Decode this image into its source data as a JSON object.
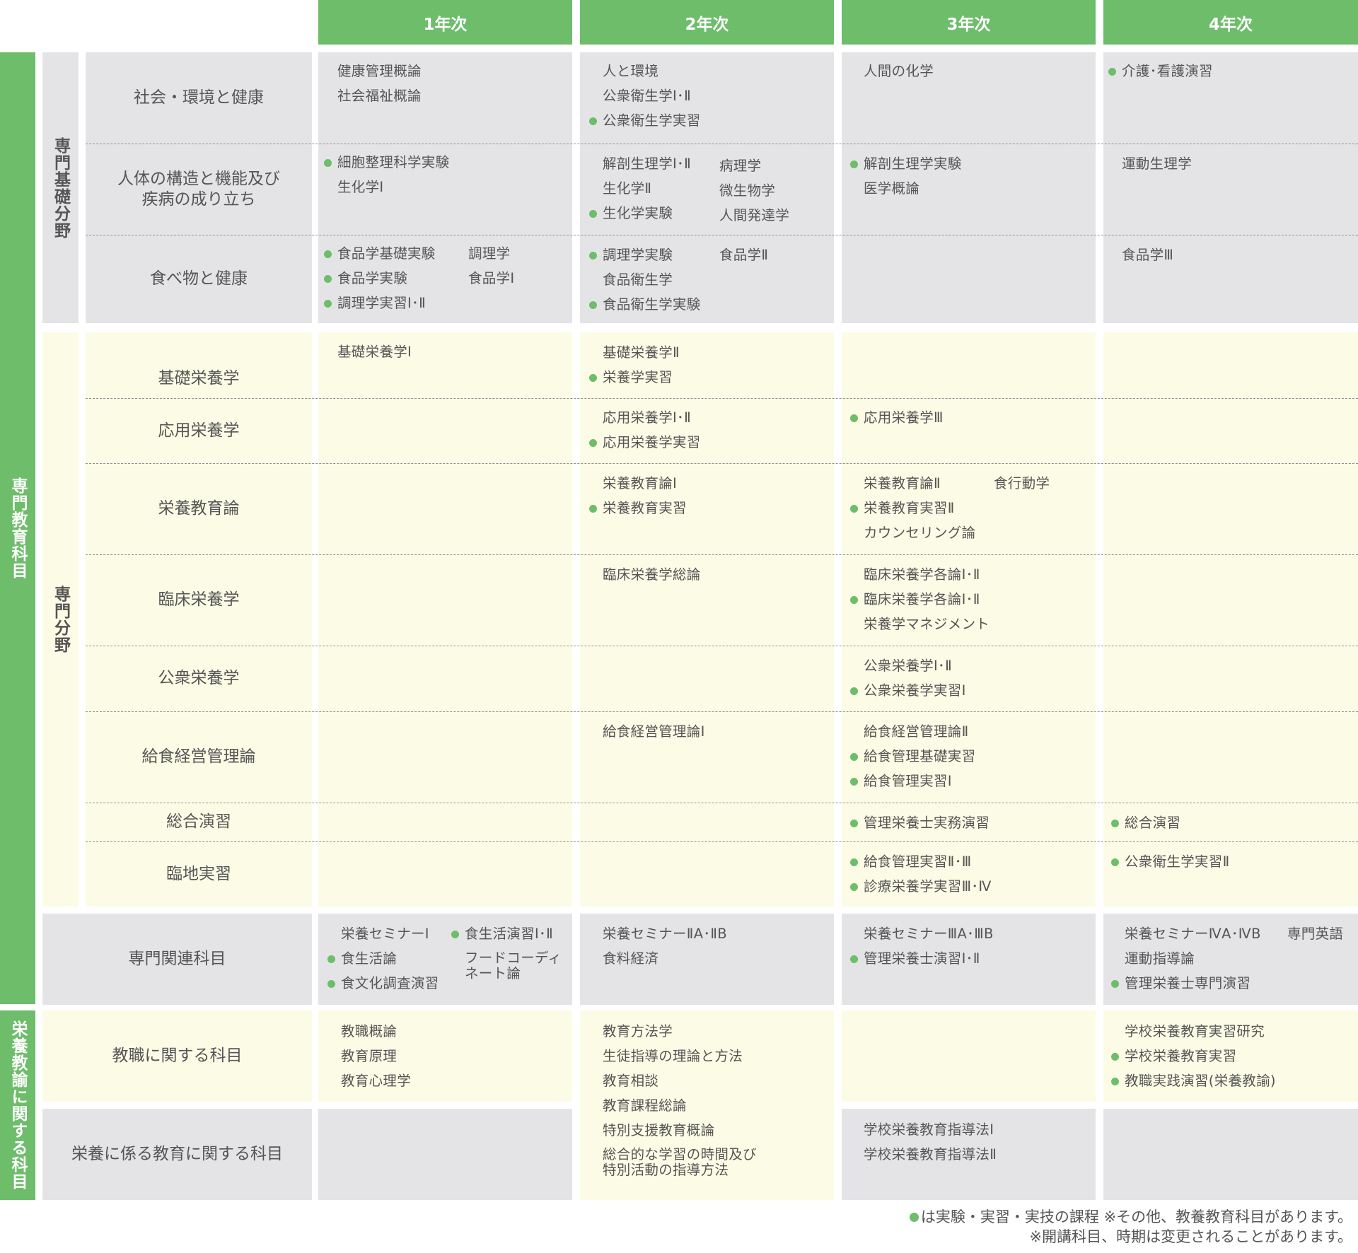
{
  "years": [
    "1年次",
    "2年次",
    "3年次",
    "4年次"
  ],
  "groups": {
    "senmon_kyoiku": "専門教育科目",
    "eiyo_kyoyu": "栄養教諭に関する科目"
  },
  "subgroups": {
    "kiso": "専門基礎分野",
    "senmon": "専門分野"
  },
  "rows": {
    "r1": {
      "label": "社会・環境と健康",
      "y1": [
        "健康管理概論",
        "社会福祉概論"
      ],
      "y2": [
        "人と環境",
        "公衆衛生学Ⅰ･Ⅱ",
        "公衆衛生学実習"
      ],
      "y3": [
        "人間の化学"
      ],
      "y4": [
        "介護･看護演習"
      ]
    },
    "r2": {
      "label": "人体の構造と機能及び\n疾病の成り立ち",
      "y1": [
        "細胞整理科学実験",
        "生化学Ⅰ"
      ],
      "y2": [
        "解剖生理学Ⅰ･Ⅱ",
        "生化学Ⅱ",
        "生化学実験",
        "病理学",
        "微生物学",
        "人間発達学"
      ],
      "y3": [
        "解剖生理学実験",
        "医学概論"
      ],
      "y4": [
        "運動生理学"
      ]
    },
    "r3": {
      "label": "食べ物と健康",
      "y1": [
        "食品学基礎実験",
        "食品学実験",
        "調理学実習Ⅰ･Ⅱ",
        "調理学",
        "食品学Ⅰ"
      ],
      "y2": [
        "調理学実験",
        "食品衛生学",
        "食品衛生学実験",
        "食品学Ⅱ"
      ],
      "y4": [
        "食品学Ⅲ"
      ]
    },
    "r4": {
      "label": "基礎栄養学",
      "y1": [
        "基礎栄養学Ⅰ"
      ],
      "y2": [
        "基礎栄養学Ⅱ",
        "栄養学実習"
      ]
    },
    "r5": {
      "label": "応用栄養学",
      "y2": [
        "応用栄養学Ⅰ･Ⅱ",
        "応用栄養学実習"
      ],
      "y3": [
        "応用栄養学Ⅲ"
      ]
    },
    "r6": {
      "label": "栄養教育論",
      "y2": [
        "栄養教育論Ⅰ",
        "栄養教育実習"
      ],
      "y3": [
        "栄養教育論Ⅱ",
        "栄養教育実習Ⅱ",
        "カウンセリング論",
        "食行動学"
      ]
    },
    "r7": {
      "label": "臨床栄養学",
      "y2": [
        "臨床栄養学総論"
      ],
      "y3": [
        "臨床栄養学各論Ⅰ･Ⅱ",
        "臨床栄養学各論Ⅰ･Ⅱ",
        "栄養学マネジメント"
      ]
    },
    "r8": {
      "label": "公衆栄養学",
      "y3": [
        "公衆栄養学Ⅰ･Ⅱ",
        "公衆栄養学実習Ⅰ"
      ]
    },
    "r9": {
      "label": "給食経営管理論",
      "y2": [
        "給食経営管理論Ⅰ"
      ],
      "y3": [
        "給食経営管理論Ⅱ",
        "給食管理基礎実習",
        "給食管理実習Ⅰ"
      ]
    },
    "r10": {
      "label": "総合演習",
      "y3": [
        "管理栄養士実務演習"
      ],
      "y4": [
        "総合演習"
      ]
    },
    "r11": {
      "label": "臨地実習",
      "y3": [
        "給食管理実習Ⅱ･Ⅲ",
        "診療栄養学実習Ⅲ･Ⅳ"
      ],
      "y4": [
        "公衆衛生学実習Ⅱ"
      ]
    },
    "r12": {
      "label": "専門関連科目",
      "y1": [
        "栄養セミナーⅠ",
        "食生活論",
        "食文化調査演習",
        "食生活演習Ⅰ･Ⅱ",
        "フードコーディ\nネート論"
      ],
      "y2": [
        "栄養セミナーⅡA･ⅡB",
        "食料経済"
      ],
      "y3": [
        "栄養セミナーⅢA･ⅢB",
        "管理栄養士演習Ⅰ･Ⅱ"
      ],
      "y4": [
        "栄養セミナーⅣA･ⅣB",
        "運動指導論",
        "管理栄養士専門演習",
        "専門英語"
      ]
    },
    "r13": {
      "label": "教職に関する科目",
      "y1": [
        "教職概論",
        "教育原理",
        "教育心理学"
      ],
      "y2": [
        "教育方法学",
        "生徒指導の理論と方法",
        "教育相談",
        "教育課程総論",
        "特別支援教育概論",
        "総合的な学習の時間及び\n特別活動の指導方法"
      ],
      "y4": [
        "学校栄養教育実習研究",
        "学校栄養教育実習",
        "教職実践演習(栄養教諭)"
      ]
    },
    "r14": {
      "label": "栄養に係る教育に関する科目",
      "y3": [
        "学校栄養教育指導法Ⅰ",
        "学校栄養教育指導法Ⅱ"
      ]
    }
  },
  "notes": {
    "legend": "は実験・実習・実技の課程 ※その他、教養教育科目があります。",
    "change": "※開講科目、時期は変更されることがあります。"
  },
  "colors": {
    "green": "#6dbd6b",
    "gray_cell": "#e4e4e6",
    "cream_cell": "#fcfce6",
    "text": "#555555"
  }
}
